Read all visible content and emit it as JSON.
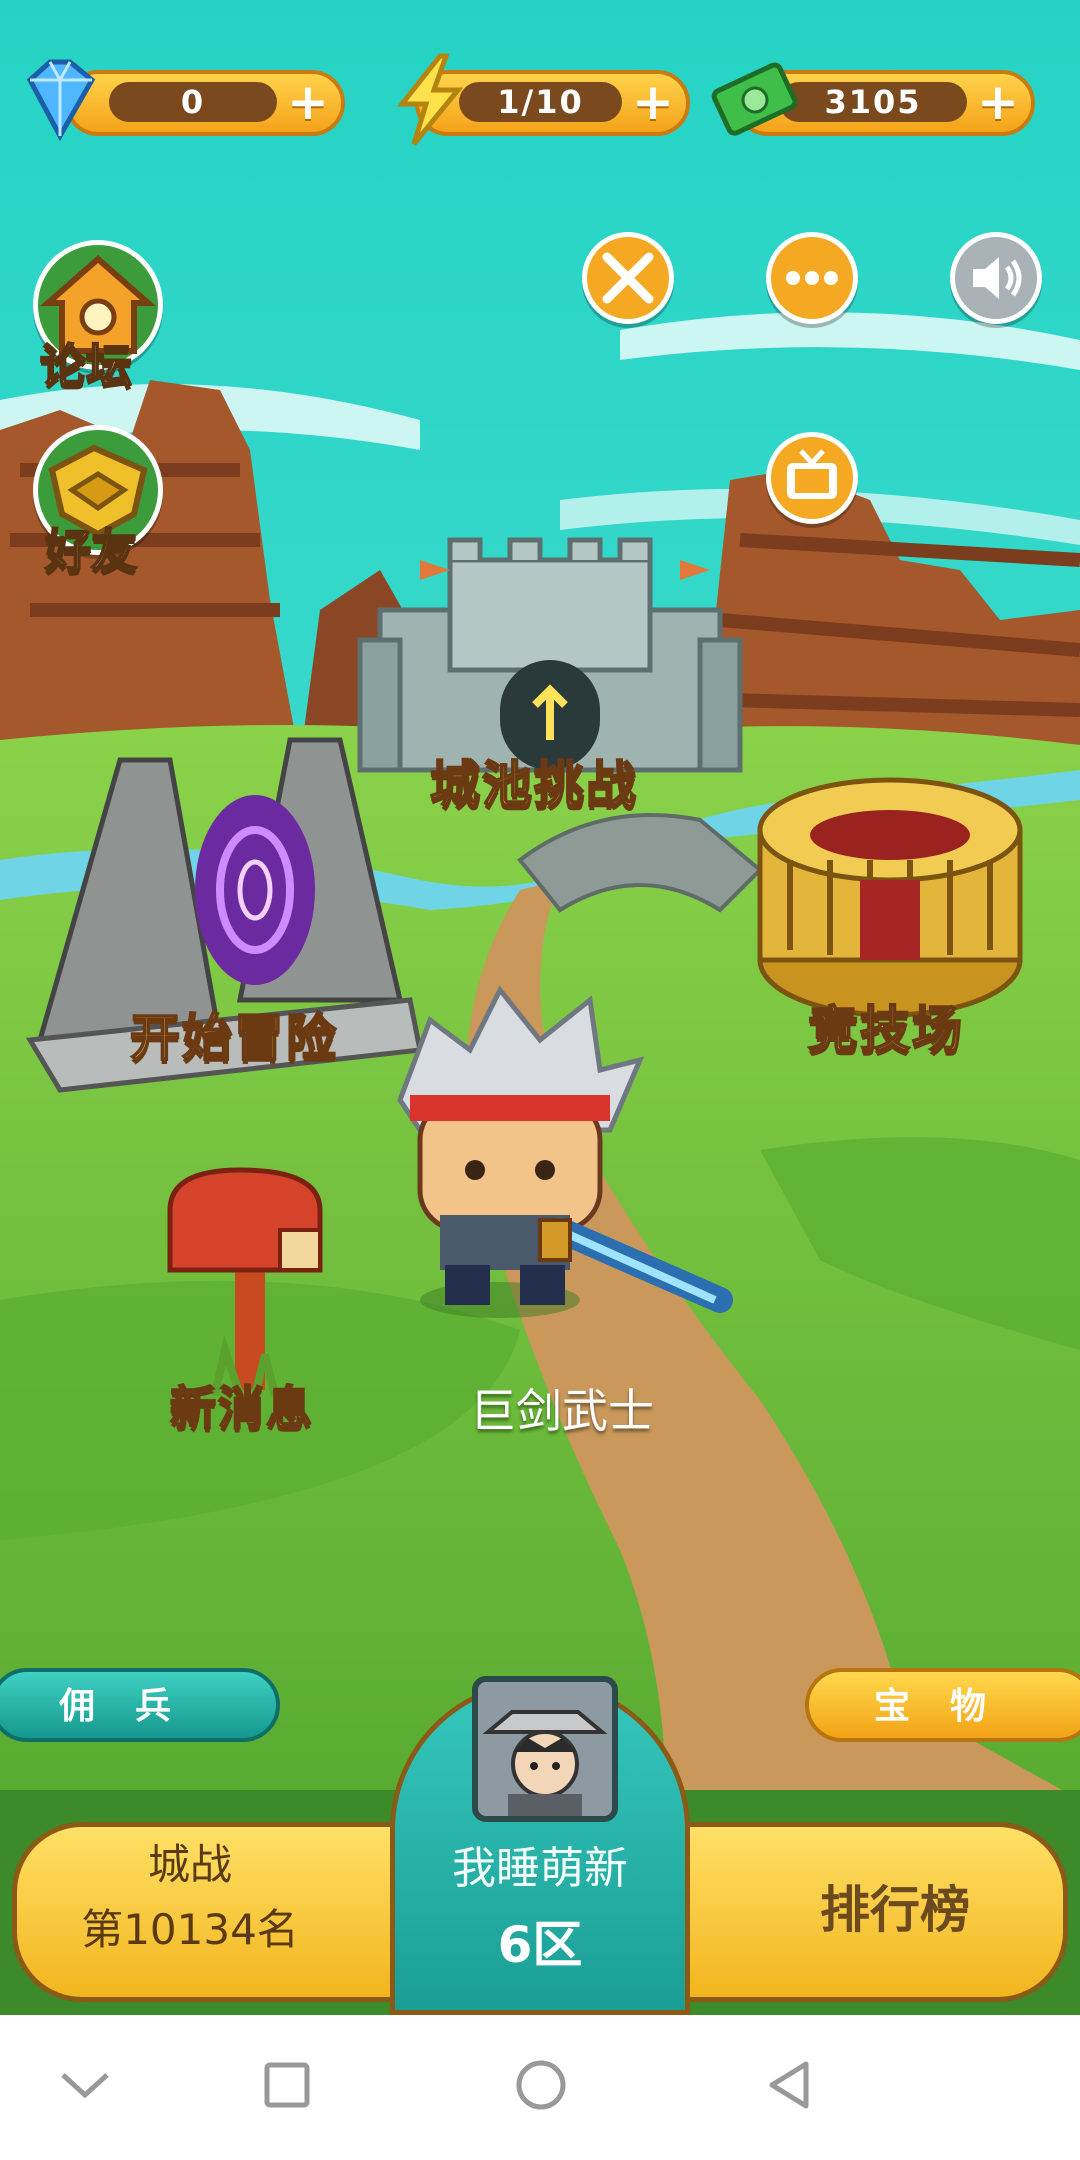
{
  "resources": {
    "gems": {
      "value": "0",
      "icon": "diamond-icon"
    },
    "energy": {
      "value": "1/10",
      "icon": "lightning-icon"
    },
    "cash": {
      "value": "3105",
      "icon": "cash-stack-icon"
    },
    "add_symbol": "+"
  },
  "side_menu": {
    "forum": "论坛",
    "friends": "好友"
  },
  "top_buttons": {
    "battle_icon": "crossed-swords-icon",
    "more_icon": "more-icon",
    "sound_icon": "speaker-icon",
    "tv_icon": "tv-icon"
  },
  "map_locations": {
    "castle_challenge": "城池挑战",
    "start_adventure": "开始冒险",
    "arena": "竞技场",
    "new_messages": "新消息"
  },
  "hero": {
    "name": "巨剑武士"
  },
  "bottom": {
    "mercenary": "佣兵",
    "treasure": "宝物",
    "city_battle_title": "城战",
    "city_battle_rank": "第10134名",
    "player_name": "我睡萌新",
    "server": "6区",
    "leaderboard": "排行榜"
  },
  "colors": {
    "sky": "#2fd6c6",
    "grass": "#6cc23a",
    "path": "#c9985a",
    "gold": "#f7c630",
    "teal_button": "#1fb3a7"
  }
}
